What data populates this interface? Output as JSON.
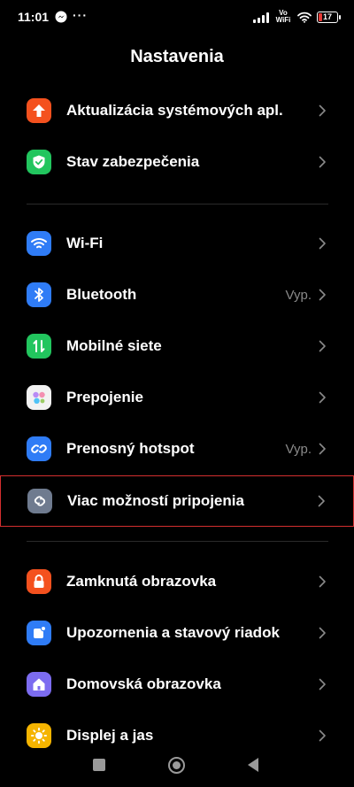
{
  "status_bar": {
    "time": "11:01",
    "overflow": "···",
    "vowifi_top": "Vo",
    "vowifi_bottom": "WiFi",
    "battery_level": "17",
    "battery_fraction": 0.17,
    "battery_color": "#e53935"
  },
  "header": {
    "title": "Nastavenia"
  },
  "sections": [
    {
      "items": [
        {
          "label": "Aktualizácia systémových apl.",
          "value": "",
          "icon": "arrow-up-icon",
          "color": "#f4511e"
        },
        {
          "label": "Stav zabezpečenia",
          "value": "",
          "icon": "shield-check-icon",
          "color": "#22c55e"
        }
      ]
    },
    {
      "items": [
        {
          "label": "Wi-Fi",
          "value": "",
          "icon": "wifi-icon",
          "color": "#2f7cf6"
        },
        {
          "label": "Bluetooth",
          "value": "Vyp.",
          "icon": "bluetooth-icon",
          "color": "#2f7cf6"
        },
        {
          "label": "Mobilné siete",
          "value": "",
          "icon": "mobile-data-icon",
          "color": "#22c55e"
        },
        {
          "label": "Prepojenie",
          "value": "",
          "icon": "connect-dots-icon",
          "color": "#f2f2f2"
        },
        {
          "label": "Prenosný hotspot",
          "value": "Vyp.",
          "icon": "hotspot-link-icon",
          "color": "#2f7cf6"
        },
        {
          "label": "Viac možností pripojenia",
          "value": "",
          "icon": "link-icon",
          "color": "#6f7b8f"
        }
      ]
    },
    {
      "items": [
        {
          "label": "Zamknutá obrazovka",
          "value": "",
          "icon": "lock-icon",
          "color": "#f4511e"
        },
        {
          "label": "Upozornenia a stavový riadok",
          "value": "",
          "icon": "notification-icon",
          "color": "#2f7cf6"
        },
        {
          "label": "Domovská obrazovka",
          "value": "",
          "icon": "home-icon",
          "color": "#7c6cf0"
        },
        {
          "label": "Displej a jas",
          "value": "",
          "icon": "sun-icon",
          "color": "#f5b400"
        }
      ]
    }
  ],
  "colors": {
    "background": "#000000",
    "highlight_border": "#d32f2f",
    "secondary_text": "#8a8a8a"
  }
}
